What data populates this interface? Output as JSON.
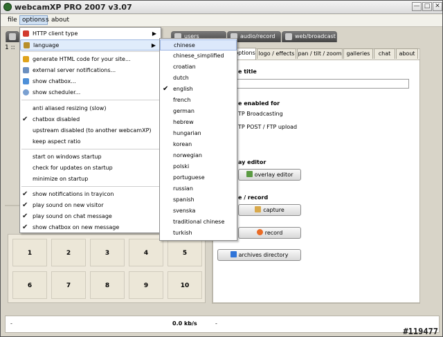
{
  "window": {
    "title": "webcamXP PRO 2007 v3.07",
    "controls": [
      "—",
      "□",
      "✕"
    ]
  },
  "menubar": {
    "items": [
      "file",
      "options",
      "s",
      "about"
    ],
    "active": "options"
  },
  "toolbar": {
    "items": [
      "users manager",
      "audio/record",
      "web/broadcast"
    ]
  },
  "left": {
    "slot_label": "1 ::",
    "grid": [
      "1",
      "2",
      "3",
      "4",
      "5",
      "6",
      "7",
      "8",
      "9",
      "10"
    ]
  },
  "right": {
    "tabs": [
      "options",
      "logo / effects",
      "pan / tilt / zoom",
      "galleries",
      "chat",
      "about"
    ],
    "active_tab": "options",
    "labels": {
      "title": "e title",
      "enabled_for": "e enabled for",
      "tp_broadcasting": "TP Broadcasting",
      "tp_post": "TP POST / FTP upload",
      "overlay_editor_label": "ay editor",
      "capture_record_label": "e / record"
    },
    "buttons": {
      "overlay_editor": "overlay editor",
      "capture": "capture",
      "record": "record",
      "archives_directory": "archives directory"
    }
  },
  "status": {
    "left": "-",
    "rate": "0.0 kb/s",
    "right": "-"
  },
  "watermark": "#119477",
  "options_menu": {
    "items": [
      {
        "label": "HTTP client type",
        "icon": "globe-icon",
        "submenu": true
      },
      {
        "label": "language",
        "icon": "language-icon",
        "submenu": true,
        "selected": true
      },
      {
        "label": "generate HTML code for your site...",
        "icon": "html-icon"
      },
      {
        "label": "external server notifications...",
        "icon": "server-icon"
      },
      {
        "label": "show chatbox...",
        "icon": "chat-icon"
      },
      {
        "label": "show scheduler...",
        "icon": "clock-icon"
      },
      {
        "label": "anti aliased resizing (slow)",
        "checked": false
      },
      {
        "label": "chatbox disabled",
        "checked": true
      },
      {
        "label": "upstream disabled (to another webcamXP)",
        "checked": false
      },
      {
        "label": "keep aspect ratio",
        "checked": false
      },
      {
        "label": "start on windows startup",
        "checked": false
      },
      {
        "label": "check for updates on startup",
        "checked": false
      },
      {
        "label": "minimize on startup",
        "checked": false
      },
      {
        "label": "show notifications in trayicon",
        "checked": true
      },
      {
        "label": "play sound on new visitor",
        "checked": true
      },
      {
        "label": "play sound on chat message",
        "checked": true
      },
      {
        "label": "show chatbox on new message",
        "checked": true
      }
    ]
  },
  "language_menu": {
    "items": [
      "chinese",
      "chinese_simplified",
      "croatian",
      "dutch",
      "english",
      "french",
      "german",
      "hebrew",
      "hungarian",
      "korean",
      "norwegian",
      "polski",
      "portuguese",
      "russian",
      "spanish",
      "svenska",
      "traditional chinese",
      "turkish"
    ],
    "highlighted": "chinese",
    "checked": "english"
  }
}
